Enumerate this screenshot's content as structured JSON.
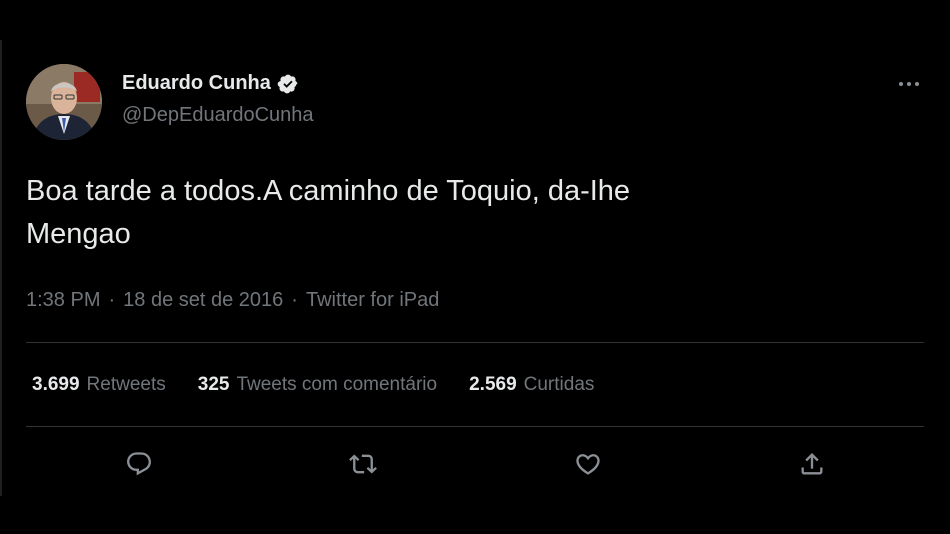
{
  "author": {
    "display_name": "Eduardo Cunha",
    "handle": "@DepEduardoCunha",
    "verified": true
  },
  "tweet": {
    "text_line1": "Boa tarde a todos.A caminho de Toquio, da-Ihe",
    "text_line2": "Mengao"
  },
  "meta": {
    "time": "1:38 PM",
    "separator": "·",
    "date": "18 de set de 2016",
    "source": "Twitter for iPad"
  },
  "stats": [
    {
      "count": "3.699",
      "label": "Retweets"
    },
    {
      "count": "325",
      "label": "Tweets com comentário"
    },
    {
      "count": "2.569",
      "label": "Curtidas"
    }
  ],
  "actions": {
    "reply_icon": "reply-icon",
    "retweet_icon": "retweet-icon",
    "like_icon": "heart-icon",
    "share_icon": "share-icon"
  },
  "colors": {
    "background": "#000000",
    "text_primary": "#e7e9ea",
    "text_secondary": "#71767b",
    "divider": "#2f3336"
  }
}
